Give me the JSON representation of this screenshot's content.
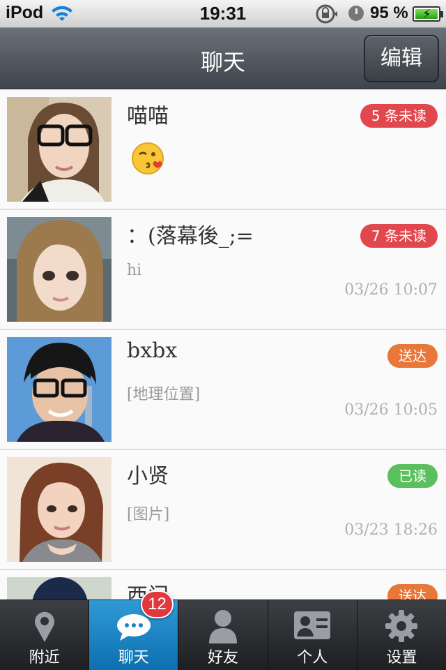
{
  "status_bar": {
    "carrier": "iPod",
    "time": "19:31",
    "battery_percent": "95 %",
    "battery_level": 0.95,
    "icons": [
      "wifi-icon",
      "rotation-lock-icon",
      "alarm-icon",
      "battery-charging-icon"
    ]
  },
  "nav": {
    "title": "聊天",
    "edit_label": "编辑"
  },
  "colors": {
    "unread_badge": "#e0484e",
    "sent_badge": "#e8773a",
    "read_badge": "#5cbf5e",
    "tab_active": "#1a83c4",
    "nav_bar": "#52585f"
  },
  "chats": [
    {
      "name": "喵喵",
      "preview": "",
      "preview_icon": "kissing-face-emoji-icon",
      "time": "",
      "badge": "5 条未读",
      "badge_type": "unread"
    },
    {
      "name": "：(落幕後_;=",
      "preview": "hi",
      "time": "03/26 10:07",
      "badge": "7 条未读",
      "badge_type": "unread"
    },
    {
      "name": "bxbx",
      "preview": "[地理位置]",
      "time": "03/26 10:05",
      "badge": "送达",
      "badge_type": "sent"
    },
    {
      "name": "小贤",
      "preview": "[图片]",
      "time": "03/23 18:26",
      "badge": "已读",
      "badge_type": "read"
    },
    {
      "name": "西门",
      "preview": "",
      "time": "",
      "badge": "送达",
      "badge_type": "sent"
    }
  ],
  "tabs": [
    {
      "label": "附近",
      "icon": "location-pin-icon",
      "active": false
    },
    {
      "label": "聊天",
      "icon": "chat-bubble-icon",
      "active": true,
      "badge": "12"
    },
    {
      "label": "好友",
      "icon": "person-icon",
      "active": false
    },
    {
      "label": "个人",
      "icon": "profile-card-icon",
      "active": false
    },
    {
      "label": "设置",
      "icon": "gear-icon",
      "active": false
    }
  ]
}
